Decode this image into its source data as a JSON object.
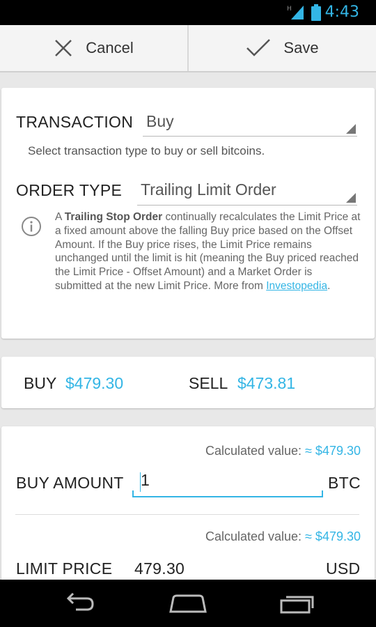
{
  "status_bar": {
    "time": "4:43",
    "network": "H"
  },
  "action_bar": {
    "cancel_label": "Cancel",
    "save_label": "Save"
  },
  "transaction": {
    "label": "TRANSACTION",
    "value": "Buy",
    "hint": "Select transaction type to buy or sell bitcoins."
  },
  "order_type": {
    "label": "ORDER TYPE",
    "value": "Trailing Limit Order",
    "info_prefix": "A ",
    "info_bold": "Trailing Stop Order",
    "info_body": " continually recalculates the Limit Price at a fixed amount above the falling Buy price based on the Offset Amount. If the Buy price rises, the Limit Price remains unchanged until the limit is hit (meaning the Buy priced reached the Limit Price - Offset Amount) and a Market Order is submitted at the new Limit Price. More from ",
    "info_link": "Investopedia",
    "info_suffix": "."
  },
  "prices": {
    "buy_label": "BUY",
    "buy_value": "$479.30",
    "sell_label": "SELL",
    "sell_value": "$473.81"
  },
  "buy_amount": {
    "calc_label": "Calculated value: ",
    "calc_value": "≈ $479.30",
    "label": "BUY AMOUNT",
    "value": "1",
    "unit": "BTC"
  },
  "limit_price": {
    "calc_label": "Calculated value: ",
    "calc_value": "≈ $479.30",
    "label": "LIMIT PRICE",
    "value": "479.30",
    "unit": "USD"
  },
  "colors": {
    "accent": "#33b5e5",
    "status_bar": "#000000",
    "background": "#e8e8e8"
  }
}
